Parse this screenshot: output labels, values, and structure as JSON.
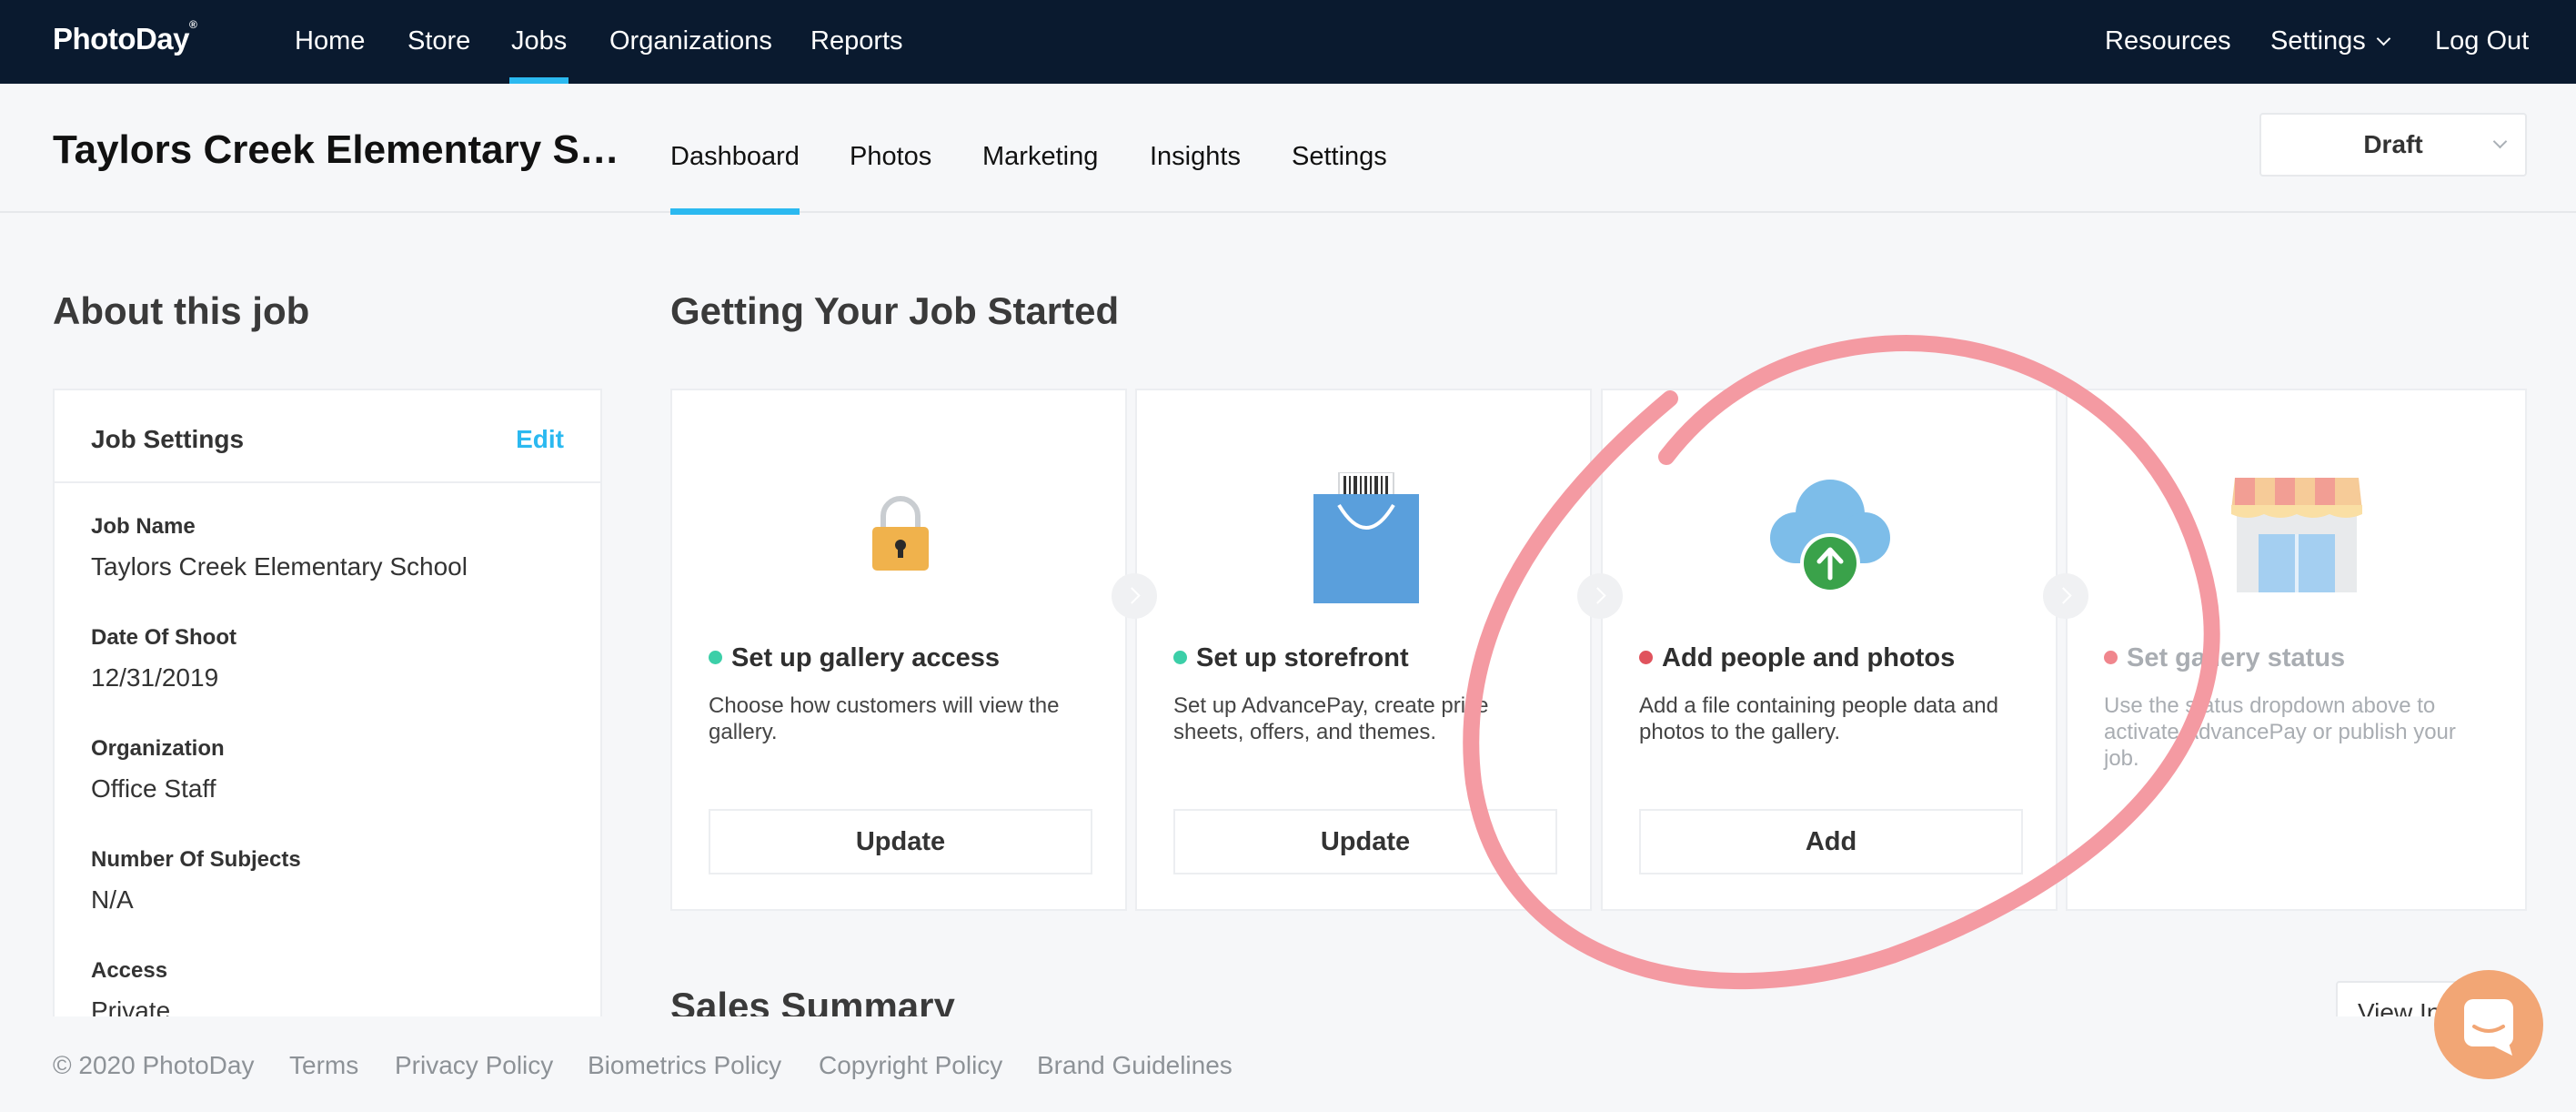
{
  "brand": {
    "logo_text": "PhotoDay",
    "logo_mark": "®"
  },
  "topnav": {
    "left": [
      "Home",
      "Store",
      "Jobs",
      "Organizations",
      "Reports"
    ],
    "active": "Jobs",
    "right": [
      "Resources",
      "Settings",
      "Log Out"
    ]
  },
  "job": {
    "title": "Taylors Creek Elementary S…",
    "tabs": [
      "Dashboard",
      "Photos",
      "Marketing",
      "Insights",
      "Settings"
    ],
    "active_tab": "Dashboard",
    "status": "Draft"
  },
  "about": {
    "heading": "About this job",
    "panel_title": "Job Settings",
    "edit_label": "Edit",
    "fields": [
      {
        "label": "Job Name",
        "value": "Taylors Creek Elementary School"
      },
      {
        "label": "Date Of Shoot",
        "value": "12/31/2019"
      },
      {
        "label": "Organization",
        "value": "Office Staff"
      },
      {
        "label": "Number Of Subjects",
        "value": "N/A"
      },
      {
        "label": "Access",
        "value": "Private"
      }
    ]
  },
  "getting_started": {
    "heading": "Getting Your Job Started",
    "cards": [
      {
        "icon": "lock-icon",
        "status_color": "#3ccfa8",
        "title": "Set up gallery access",
        "desc": "Choose how customers will view the gallery.",
        "button": "Update"
      },
      {
        "icon": "shopping-bag-icon",
        "status_color": "#3ccfa8",
        "title": "Set up storefront",
        "desc": "Set up AdvancePay, create price sheets, offers, and themes.",
        "button": "Update"
      },
      {
        "icon": "cloud-upload-icon",
        "status_color": "#e0535d",
        "title": "Add people and photos",
        "desc": "Add a file containing people data and photos to the gallery.",
        "button": "Add"
      },
      {
        "icon": "storefront-icon",
        "status_color": "#f0868d",
        "title": "Set gallery status",
        "desc": "Use the status dropdown above to activate AdvancePay or publish your job.",
        "button": ""
      }
    ]
  },
  "sales": {
    "heading": "Sales Summary",
    "view_label": "View Insights"
  },
  "footer": [
    "© 2020 PhotoDay",
    "Terms",
    "Privacy Policy",
    "Biometrics Policy",
    "Copyright Policy",
    "Brand Guidelines"
  ],
  "colors": {
    "nav_bg": "#0a1a2f",
    "accent": "#2bb9f0",
    "annotation": "#f49aa2",
    "chat": "#f2a675"
  }
}
